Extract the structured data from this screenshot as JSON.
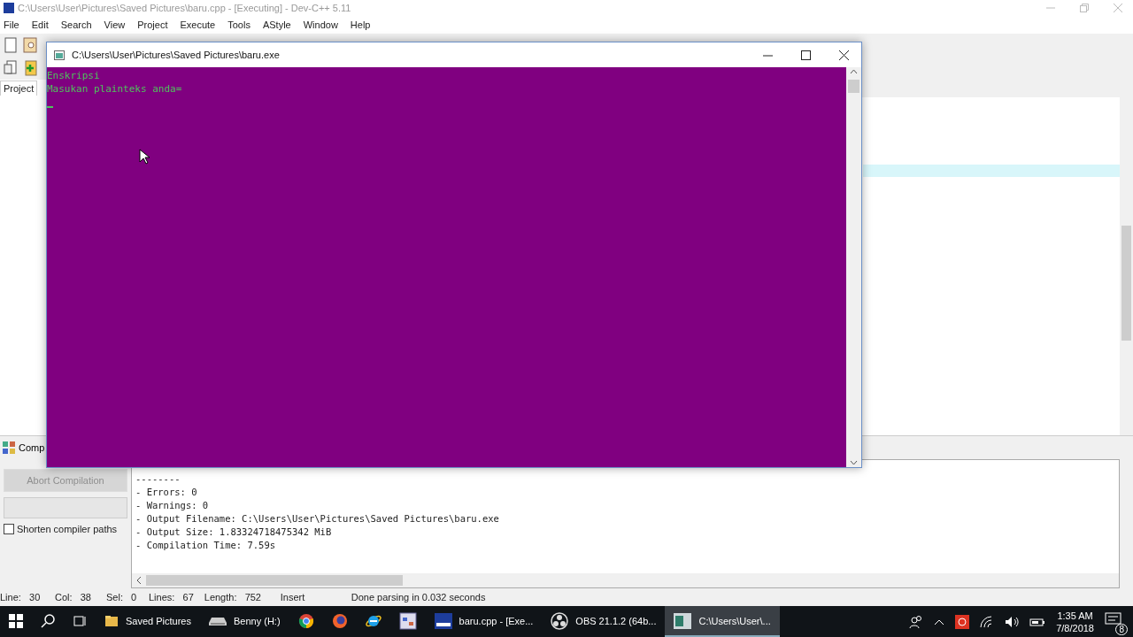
{
  "ide": {
    "title": "C:\\Users\\User\\Pictures\\Saved Pictures\\baru.cpp - [Executing] - Dev-C++ 5.11",
    "menu": [
      "File",
      "Edit",
      "Search",
      "View",
      "Project",
      "Execute",
      "Tools",
      "AStyle",
      "Window",
      "Help"
    ],
    "project_tab": "Project",
    "compiler_tab": "Comp",
    "abort_button": {
      "label": "Abort Compilation",
      "disabled": true
    },
    "shorten_paths": {
      "label": "Shorten compiler paths",
      "checked": false
    },
    "log": [
      "--------",
      "- Errors: 0",
      "- Warnings: 0",
      "- Output Filename: C:\\Users\\User\\Pictures\\Saved Pictures\\baru.exe",
      "- Output Size: 1.83324718475342 MiB",
      "- Compilation Time: 7.59s"
    ]
  },
  "status_bar": [
    {
      "label": "Line:",
      "value": "30"
    },
    {
      "label": "Col:",
      "value": "38"
    },
    {
      "label": "Sel:",
      "value": "0"
    },
    {
      "label": "Lines:",
      "value": "67"
    },
    {
      "label": "Length:",
      "value": "752"
    },
    {
      "label": "Insert"
    },
    {
      "label": "Done parsing in 0.032 seconds"
    }
  ],
  "console": {
    "title": "C:\\Users\\User\\Pictures\\Saved Pictures\\baru.exe",
    "lines": [
      "Enskripsi",
      "Masukan plainteks anda="
    ]
  },
  "taskbar": {
    "items": [
      {
        "kind": "folder",
        "label": "Saved Pictures",
        "selected": false
      },
      {
        "kind": "drive",
        "label": "Benny  (H:)",
        "selected": false
      },
      {
        "kind": "chrome",
        "selected": false
      },
      {
        "kind": "firefox",
        "selected": false
      },
      {
        "kind": "ie",
        "selected": false
      },
      {
        "kind": "app",
        "selected": false
      },
      {
        "kind": "devcpp",
        "label": "baru.cpp - [Exe...",
        "selected": false
      },
      {
        "kind": "obs",
        "label": "OBS 21.1.2 (64b...",
        "selected": false
      },
      {
        "kind": "console",
        "label": "C:\\Users\\User\\...",
        "selected": true
      }
    ],
    "time": "1:35 AM",
    "date": "7/8/2018",
    "notifications": "8"
  }
}
